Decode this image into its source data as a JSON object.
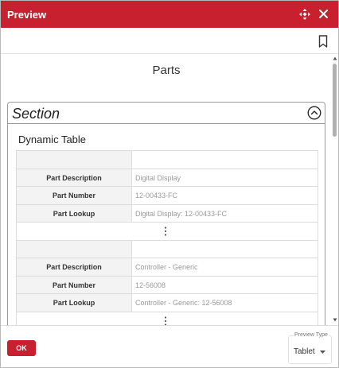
{
  "dialog": {
    "title": "Preview",
    "icons": {
      "move": "move-arrows-icon",
      "close": "close-icon",
      "bookmark": "bookmark-icon"
    }
  },
  "page": {
    "title": "Parts",
    "section": {
      "title": "Section",
      "collapse_icon": "chevron-up-circle-icon",
      "dynamic_table": {
        "title": "Dynamic Table",
        "records": [
          {
            "fields": [
              {
                "label": "Part Description",
                "value": "Digital Display"
              },
              {
                "label": "Part Number",
                "value": "12-00433-FC"
              },
              {
                "label": "Part Lookup",
                "value": "Digital Display: 12-00433-FC"
              }
            ],
            "row_menu_icon": "more-vertical-icon"
          },
          {
            "fields": [
              {
                "label": "Part Description",
                "value": "Controller - Generic"
              },
              {
                "label": "Part Number",
                "value": "12-56008"
              },
              {
                "label": "Part Lookup",
                "value": "Controller - Generic: 12-56008"
              }
            ],
            "row_menu_icon": "more-vertical-icon"
          }
        ]
      }
    }
  },
  "footer": {
    "ok_label": "OK",
    "preview_type": {
      "label": "Preview Type",
      "value": "Tablet",
      "caret_icon": "caret-down-icon"
    }
  },
  "colors": {
    "accent": "#c8202f",
    "label_bg": "#f3f3f3",
    "border": "#dcdcdc",
    "value_text": "#9a9a9a"
  }
}
